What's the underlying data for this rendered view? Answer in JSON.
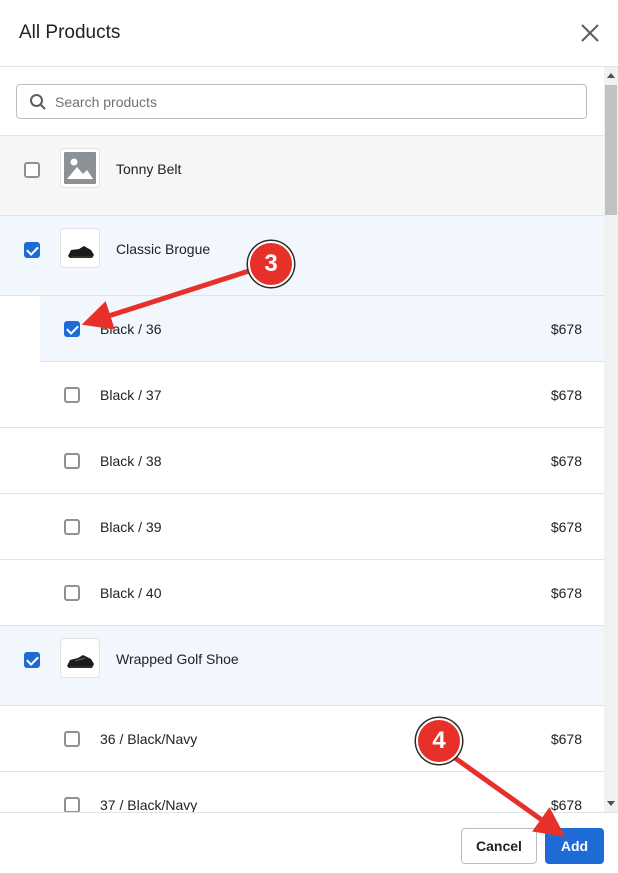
{
  "dialog": {
    "title": "All Products"
  },
  "search": {
    "placeholder": "Search products",
    "value": ""
  },
  "products": [
    {
      "name": "Tonny Belt",
      "checked": false,
      "image": "placeholder-image-icon"
    },
    {
      "name": "Classic Brogue",
      "checked": true,
      "image": "shoe-image",
      "variants": [
        {
          "name": "Black / 36",
          "price": "$678",
          "checked": true
        },
        {
          "name": "Black / 37",
          "price": "$678",
          "checked": false
        },
        {
          "name": "Black / 38",
          "price": "$678",
          "checked": false
        },
        {
          "name": "Black / 39",
          "price": "$678",
          "checked": false
        },
        {
          "name": "Black / 40",
          "price": "$678",
          "checked": false
        }
      ]
    },
    {
      "name": "Wrapped Golf Shoe",
      "checked": true,
      "image": "shoe-image",
      "variants": [
        {
          "name": "36 / Black/Navy",
          "price": "$678",
          "checked": false
        },
        {
          "name": "37 / Black/Navy",
          "price": "$678",
          "checked": false
        }
      ]
    }
  ],
  "footer": {
    "cancel_label": "Cancel",
    "add_label": "Add"
  },
  "callouts": [
    {
      "label": "3"
    },
    {
      "label": "4"
    }
  ],
  "colors": {
    "primary": "#1f6bd6",
    "selected_row": "#f2f7fe",
    "hover_row": "#f6f6f7",
    "callout": "#e8302a"
  }
}
